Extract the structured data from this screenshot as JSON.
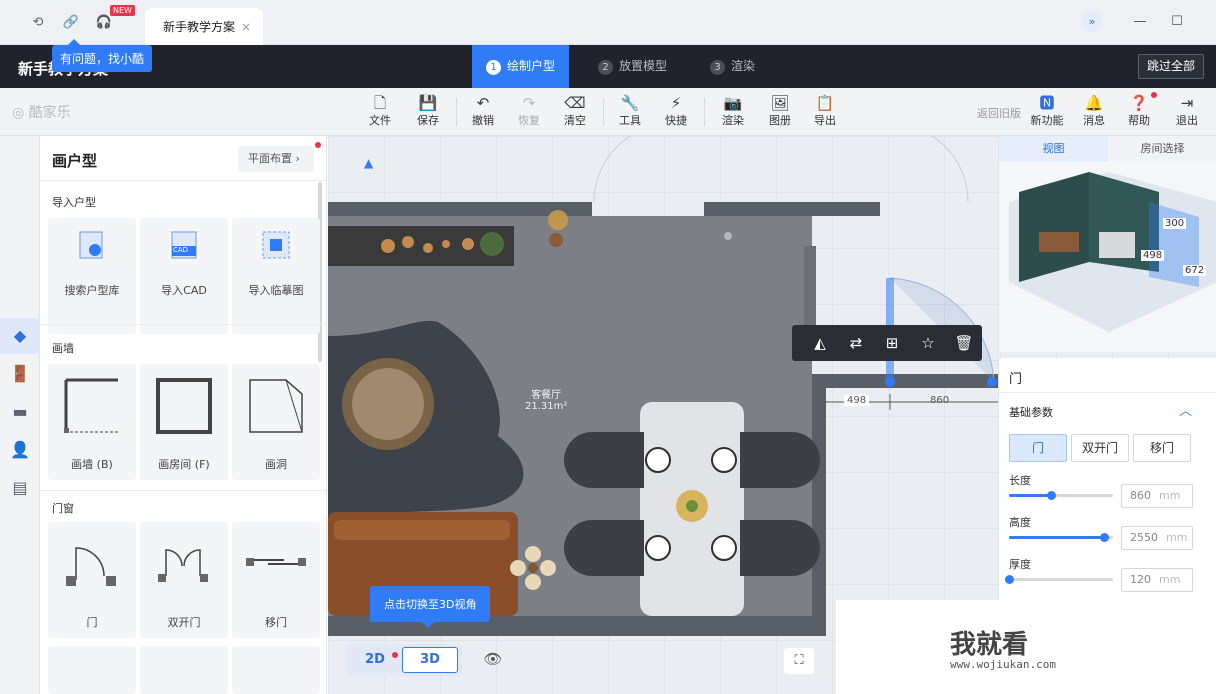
{
  "tabbar": {
    "new_badge": "NEW",
    "tab_title": "新手教学方案",
    "tab_close": "×"
  },
  "topbar": {
    "title": "新手教学方案",
    "hint": "有问题，找小酷",
    "steps": [
      {
        "num": "1",
        "label": "绘制户型"
      },
      {
        "num": "2",
        "label": "放置模型"
      },
      {
        "num": "3",
        "label": "渲染"
      }
    ],
    "skip": "跳过全部"
  },
  "toolbar": {
    "logo": "酷家乐",
    "tools": [
      "文件",
      "保存",
      "撤销",
      "恢复",
      "清空",
      "工具",
      "快捷",
      "渲染",
      "图册",
      "导出"
    ],
    "old_version": "返回旧版",
    "right": [
      "新功能",
      "消息",
      "帮助",
      "退出"
    ]
  },
  "panel": {
    "title": "画户型",
    "layout_btn": "平面布置",
    "sections": [
      {
        "title": "导入户型",
        "items": [
          "搜索户型库",
          "导入CAD",
          "导入临摹图"
        ]
      },
      {
        "title": "画墙",
        "items": [
          "画墙 (B)",
          "画房间 (F)",
          "画洞"
        ]
      },
      {
        "title": "门窗",
        "items": [
          "门",
          "双开门",
          "移门"
        ]
      }
    ],
    "cad_label": "CAD"
  },
  "canvas": {
    "room_name": "客餐厅",
    "room_area": "21.31m²",
    "dim_left": "498",
    "dim_right": "860",
    "tip_3d": "点击切换至3D视角",
    "btn_2d": "2D",
    "btn_3d": "3D"
  },
  "viewpane": {
    "tabs": [
      "视图",
      "房间选择"
    ],
    "labels": [
      "300",
      "498",
      "672"
    ]
  },
  "props": {
    "title": "门",
    "section": "基础参数",
    "types": [
      "门",
      "双开门",
      "移门"
    ],
    "params": [
      {
        "label": "长度",
        "value": "860",
        "unit": "mm",
        "level": 0.4
      },
      {
        "label": "高度",
        "value": "2550",
        "unit": "mm",
        "level": 0.91
      },
      {
        "label": "厚度",
        "value": "120",
        "unit": "mm",
        "level": 0.0
      }
    ]
  },
  "watermark": {
    "big": "我就看",
    "url": "www.wojiukan.com"
  },
  "colors": {
    "accent": "#2f7cf6",
    "dark": "#20232b",
    "badge": "#e9344a"
  }
}
